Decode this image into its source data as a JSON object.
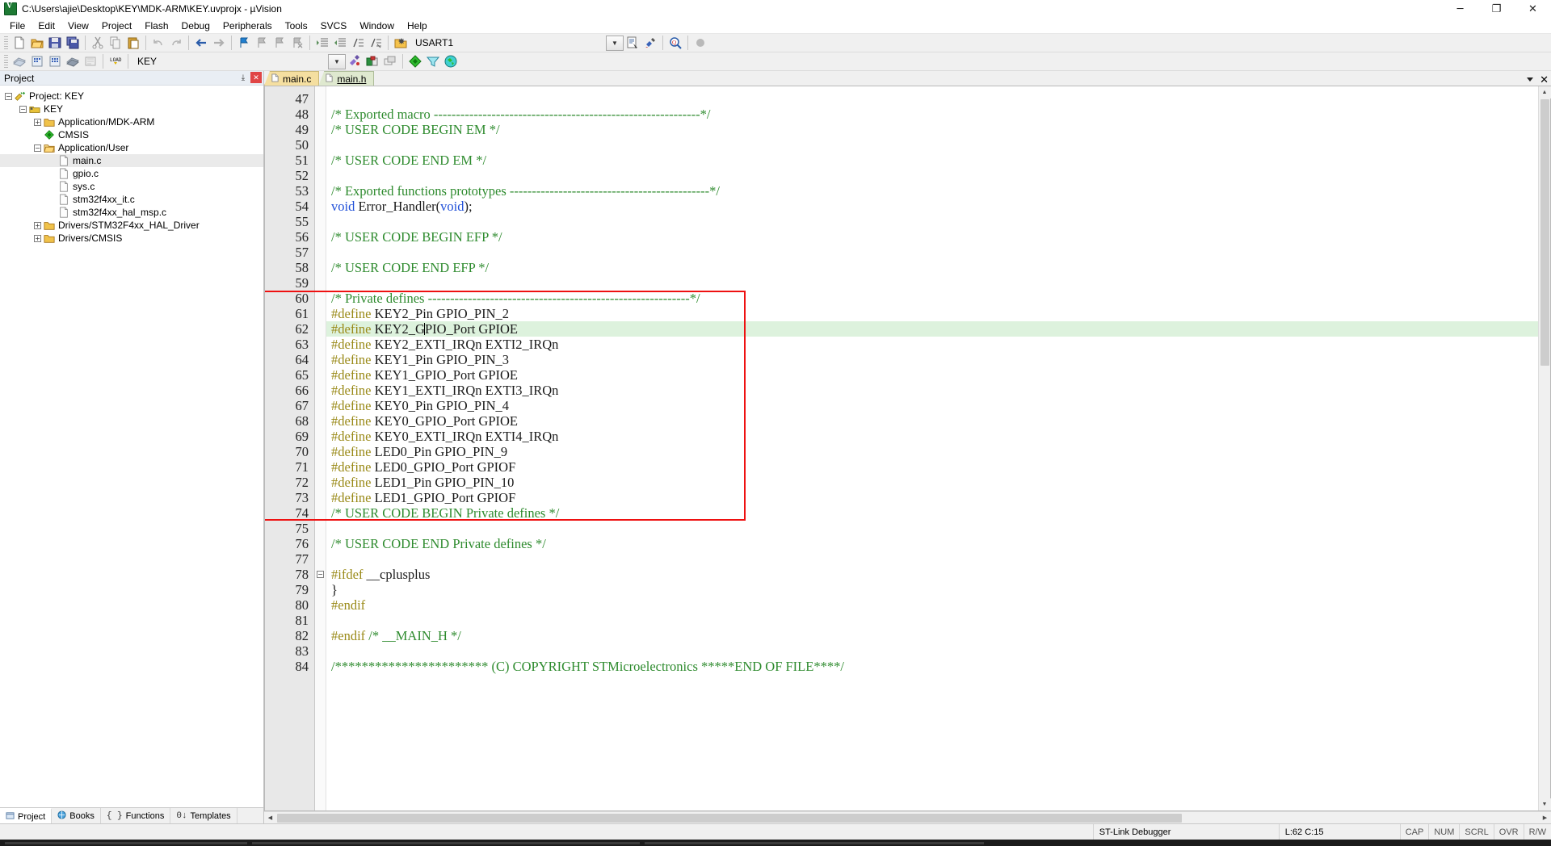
{
  "window": {
    "title": "C:\\Users\\ajie\\Desktop\\KEY\\MDK-ARM\\KEY.uvprojx - µVision",
    "app_icon": "uvision-logo-icon",
    "minimize": "─",
    "maximize": "❐",
    "close": "✕"
  },
  "menu": {
    "items": [
      {
        "label": "File"
      },
      {
        "label": "Edit"
      },
      {
        "label": "View"
      },
      {
        "label": "Project"
      },
      {
        "label": "Flash"
      },
      {
        "label": "Debug"
      },
      {
        "label": "Peripherals"
      },
      {
        "label": "Tools"
      },
      {
        "label": "SVCS"
      },
      {
        "label": "Window"
      },
      {
        "label": "Help"
      }
    ]
  },
  "toolbar_main": {
    "buttons": [
      {
        "name": "new-file-icon",
        "tip": "New"
      },
      {
        "name": "open-file-icon",
        "tip": "Open"
      },
      {
        "name": "save-icon",
        "tip": "Save"
      },
      {
        "name": "save-all-icon",
        "tip": "Save All"
      },
      {
        "name": "cut-icon",
        "tip": "Cut"
      },
      {
        "name": "copy-icon",
        "tip": "Copy"
      },
      {
        "name": "paste-icon",
        "tip": "Paste"
      },
      {
        "name": "undo-icon",
        "tip": "Undo"
      },
      {
        "name": "redo-icon",
        "tip": "Redo"
      },
      {
        "name": "navigate-backward-icon",
        "tip": "Back"
      },
      {
        "name": "navigate-forward-icon",
        "tip": "Forward"
      },
      {
        "name": "bookmark-toggle-icon",
        "tip": "Insert/Remove Bookmark"
      },
      {
        "name": "bookmark-prev-icon",
        "tip": "Previous Bookmark"
      },
      {
        "name": "bookmark-next-icon",
        "tip": "Next Bookmark"
      },
      {
        "name": "bookmark-clear-icon",
        "tip": "Clear All Bookmarks"
      },
      {
        "name": "indent-right-icon",
        "tip": "Indent"
      },
      {
        "name": "indent-left-icon",
        "tip": "Outdent"
      },
      {
        "name": "comment-icon",
        "tip": "Comment"
      },
      {
        "name": "uncomment-icon",
        "tip": "Uncomment"
      },
      {
        "name": "configuration-wizard-icon",
        "tip": "Configuration Wizard"
      }
    ],
    "device_selector": "USART1",
    "right_buttons": [
      {
        "name": "dropdown-toggle-icon"
      },
      {
        "name": "build-output-icon"
      },
      {
        "name": "debug-settings-icon"
      },
      {
        "name": "find-in-files-icon"
      },
      {
        "name": "status-dot-icon"
      }
    ]
  },
  "toolbar_build": {
    "buttons": [
      {
        "name": "translate-file-icon"
      },
      {
        "name": "build-target-icon"
      },
      {
        "name": "rebuild-all-icon"
      },
      {
        "name": "batch-build-icon"
      },
      {
        "name": "stop-build-icon"
      },
      {
        "name": "download-to-flash-icon"
      }
    ],
    "target_selector": "KEY",
    "right_buttons": [
      {
        "name": "target-options-icon"
      },
      {
        "name": "manage-components-icon"
      },
      {
        "name": "start-debug-icon"
      },
      {
        "name": "multi-project-icon"
      },
      {
        "name": "pack-installer-icon"
      },
      {
        "name": "manage-runtime-icon"
      },
      {
        "name": "filter-icon"
      },
      {
        "name": "packs-icon"
      }
    ]
  },
  "project_panel": {
    "title": "Project",
    "pin": "⤓",
    "close": "✕",
    "tree": [
      {
        "label": "Project: KEY",
        "icon": "project-icon",
        "depth": 0,
        "expander": "−",
        "selected": false
      },
      {
        "label": "KEY",
        "icon": "target-icon",
        "depth": 1,
        "expander": "−",
        "selected": false
      },
      {
        "label": "Application/MDK-ARM",
        "icon": "folder-closed-icon",
        "depth": 2,
        "expander": "+",
        "selected": false
      },
      {
        "label": "CMSIS",
        "icon": "cmsis-icon",
        "depth": 2,
        "expander": "",
        "selected": false
      },
      {
        "label": "Application/User",
        "icon": "folder-open-icon",
        "depth": 2,
        "expander": "−",
        "selected": false
      },
      {
        "label": "main.c",
        "icon": "c-file-icon",
        "depth": 3,
        "expander": "",
        "selected": true
      },
      {
        "label": "gpio.c",
        "icon": "c-file-icon",
        "depth": 3,
        "expander": "",
        "selected": false
      },
      {
        "label": "sys.c",
        "icon": "c-file-icon",
        "depth": 3,
        "expander": "",
        "selected": false
      },
      {
        "label": "stm32f4xx_it.c",
        "icon": "c-file-icon",
        "depth": 3,
        "expander": "",
        "selected": false
      },
      {
        "label": "stm32f4xx_hal_msp.c",
        "icon": "c-file-icon",
        "depth": 3,
        "expander": "",
        "selected": false
      },
      {
        "label": "Drivers/STM32F4xx_HAL_Driver",
        "icon": "folder-closed-icon",
        "depth": 2,
        "expander": "+",
        "selected": false
      },
      {
        "label": "Drivers/CMSIS",
        "icon": "folder-closed-icon",
        "depth": 2,
        "expander": "+",
        "selected": false
      }
    ],
    "bottom_tabs": [
      {
        "label": "Project",
        "icon": "project-tab-icon",
        "active": true
      },
      {
        "label": "Books",
        "icon": "books-icon",
        "active": false
      },
      {
        "label": "Functions",
        "icon": "functions-icon",
        "active": false
      },
      {
        "label": "Templates",
        "icon": "templates-icon",
        "active": false
      }
    ]
  },
  "editor": {
    "tabs": [
      {
        "label": "main.c",
        "active": false,
        "icon": "c-file-icon"
      },
      {
        "label": "main.h",
        "active": true,
        "icon": "h-file-icon"
      }
    ],
    "tab_menu_icon": "chevron-down-icon",
    "tab_close_icon": "close-icon",
    "first_line": 47,
    "highlight_line": 62,
    "lines": [
      {
        "n": 47,
        "tokens": []
      },
      {
        "n": 48,
        "tokens": [
          {
            "t": "/* Exported macro ------------------------------------------------------------*/",
            "c": "com"
          }
        ]
      },
      {
        "n": 49,
        "tokens": [
          {
            "t": "/* USER CODE BEGIN EM */",
            "c": "com"
          }
        ]
      },
      {
        "n": 50,
        "tokens": []
      },
      {
        "n": 51,
        "tokens": [
          {
            "t": "/* USER CODE END EM */",
            "c": "com"
          }
        ]
      },
      {
        "n": 52,
        "tokens": []
      },
      {
        "n": 53,
        "tokens": [
          {
            "t": "/* Exported functions prototypes ---------------------------------------------*/",
            "c": "com"
          }
        ]
      },
      {
        "n": 54,
        "tokens": [
          {
            "t": "void",
            "c": "key"
          },
          {
            "t": " Error_Handler(",
            "c": "txt"
          },
          {
            "t": "void",
            "c": "key"
          },
          {
            "t": ");",
            "c": "txt"
          }
        ]
      },
      {
        "n": 55,
        "tokens": []
      },
      {
        "n": 56,
        "tokens": [
          {
            "t": "/* USER CODE BEGIN EFP */",
            "c": "com"
          }
        ]
      },
      {
        "n": 57,
        "tokens": []
      },
      {
        "n": 58,
        "tokens": [
          {
            "t": "/* USER CODE END EFP */",
            "c": "com"
          }
        ]
      },
      {
        "n": 59,
        "tokens": []
      },
      {
        "n": 60,
        "tokens": [
          {
            "t": "/* Private defines -----------------------------------------------------------*/",
            "c": "com"
          }
        ]
      },
      {
        "n": 61,
        "tokens": [
          {
            "t": "#define",
            "c": "pre"
          },
          {
            "t": " KEY2_Pin GPIO_PIN_2",
            "c": "txt"
          }
        ]
      },
      {
        "n": 62,
        "tokens": [
          {
            "t": "#define",
            "c": "pre"
          },
          {
            "t": " KEY2_G",
            "c": "txt"
          },
          {
            "t": "|",
            "c": "caret"
          },
          {
            "t": "PIO_Port GPIOE",
            "c": "txt"
          }
        ]
      },
      {
        "n": 63,
        "tokens": [
          {
            "t": "#define",
            "c": "pre"
          },
          {
            "t": " KEY2_EXTI_IRQn EXTI2_IRQn",
            "c": "txt"
          }
        ]
      },
      {
        "n": 64,
        "tokens": [
          {
            "t": "#define",
            "c": "pre"
          },
          {
            "t": " KEY1_Pin GPIO_PIN_3",
            "c": "txt"
          }
        ]
      },
      {
        "n": 65,
        "tokens": [
          {
            "t": "#define",
            "c": "pre"
          },
          {
            "t": " KEY1_GPIO_Port GPIOE",
            "c": "txt"
          }
        ]
      },
      {
        "n": 66,
        "tokens": [
          {
            "t": "#define",
            "c": "pre"
          },
          {
            "t": " KEY1_EXTI_IRQn EXTI3_IRQn",
            "c": "txt"
          }
        ]
      },
      {
        "n": 67,
        "tokens": [
          {
            "t": "#define",
            "c": "pre"
          },
          {
            "t": " KEY0_Pin GPIO_PIN_4",
            "c": "txt"
          }
        ]
      },
      {
        "n": 68,
        "tokens": [
          {
            "t": "#define",
            "c": "pre"
          },
          {
            "t": " KEY0_GPIO_Port GPIOE",
            "c": "txt"
          }
        ]
      },
      {
        "n": 69,
        "tokens": [
          {
            "t": "#define",
            "c": "pre"
          },
          {
            "t": " KEY0_EXTI_IRQn EXTI4_IRQn",
            "c": "txt"
          }
        ]
      },
      {
        "n": 70,
        "tokens": [
          {
            "t": "#define",
            "c": "pre"
          },
          {
            "t": " LED0_Pin GPIO_PIN_9",
            "c": "txt"
          }
        ]
      },
      {
        "n": 71,
        "tokens": [
          {
            "t": "#define",
            "c": "pre"
          },
          {
            "t": " LED0_GPIO_Port GPIOF",
            "c": "txt"
          }
        ]
      },
      {
        "n": 72,
        "tokens": [
          {
            "t": "#define",
            "c": "pre"
          },
          {
            "t": " LED1_Pin GPIO_PIN_10",
            "c": "txt"
          }
        ]
      },
      {
        "n": 73,
        "tokens": [
          {
            "t": "#define",
            "c": "pre"
          },
          {
            "t": " LED1_GPIO_Port GPIOF",
            "c": "txt"
          }
        ]
      },
      {
        "n": 74,
        "tokens": [
          {
            "t": "/* USER CODE BEGIN Private defines */",
            "c": "com"
          }
        ]
      },
      {
        "n": 75,
        "tokens": []
      },
      {
        "n": 76,
        "tokens": [
          {
            "t": "/* USER CODE END Private defines */",
            "c": "com"
          }
        ]
      },
      {
        "n": 77,
        "tokens": []
      },
      {
        "n": 78,
        "tokens": [
          {
            "t": "#ifdef",
            "c": "pre"
          },
          {
            "t": " __cplusplus",
            "c": "txt"
          }
        ],
        "fold": "−"
      },
      {
        "n": 79,
        "tokens": [
          {
            "t": "}",
            "c": "txt"
          }
        ]
      },
      {
        "n": 80,
        "tokens": [
          {
            "t": "#endif",
            "c": "pre"
          }
        ]
      },
      {
        "n": 81,
        "tokens": []
      },
      {
        "n": 82,
        "tokens": [
          {
            "t": "#endif",
            "c": "pre"
          },
          {
            "t": " ",
            "c": "txt"
          },
          {
            "t": "/* __MAIN_H */",
            "c": "com"
          }
        ]
      },
      {
        "n": 83,
        "tokens": []
      },
      {
        "n": 84,
        "tokens": [
          {
            "t": "/*********************** (C) COPYRIGHT STMicroelectronics *****END OF FILE****/",
            "c": "com"
          }
        ]
      }
    ],
    "annotation": {
      "name": "red-highlight-rectangle",
      "color": "#ee1111"
    }
  },
  "statusbar": {
    "debugger": "ST-Link Debugger",
    "position": "L:62 C:15",
    "flags": [
      "CAP",
      "NUM",
      "SCRL",
      "OVR",
      "R/W"
    ]
  }
}
